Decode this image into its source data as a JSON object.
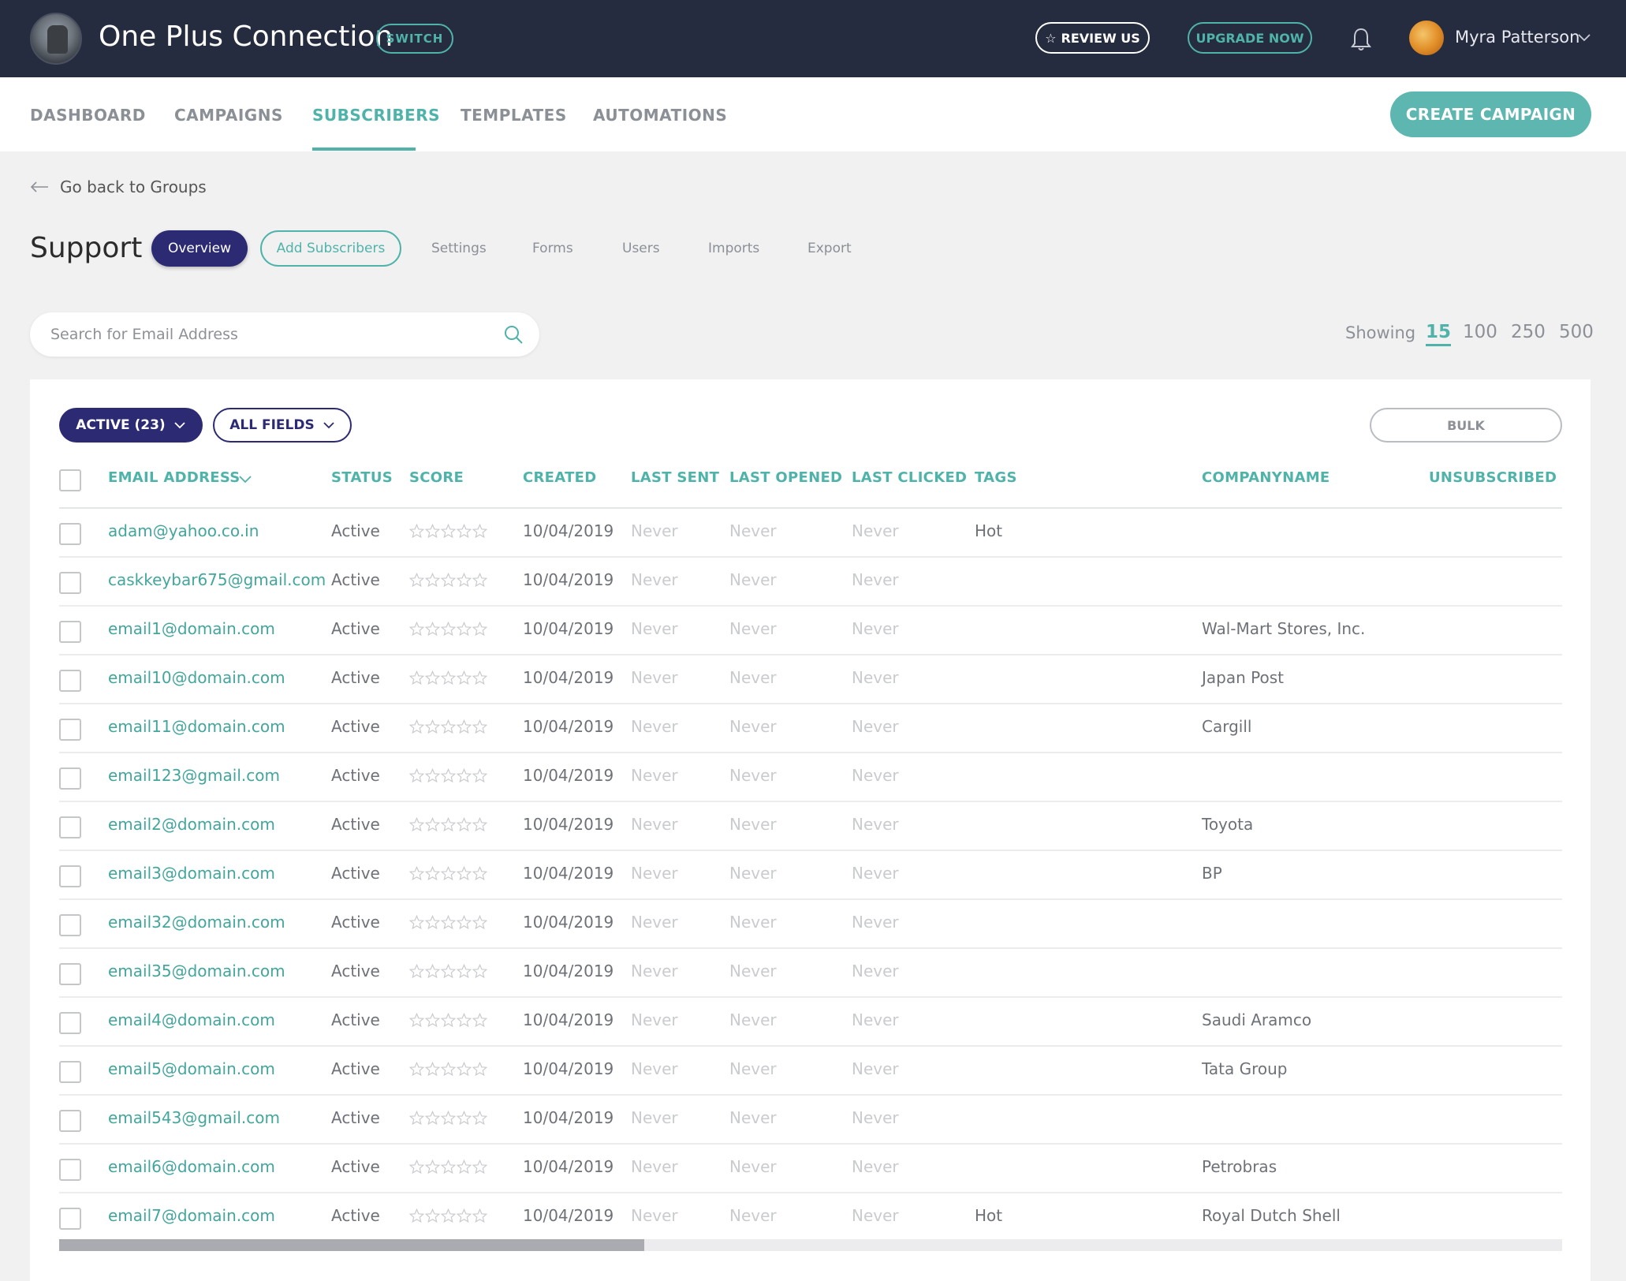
{
  "header": {
    "app_title": "One Plus Connection",
    "switch_label": "SWITCH",
    "review_label": "REVIEW US",
    "upgrade_label": "UPGRADE NOW",
    "user_name": "Myra Patterson"
  },
  "nav": {
    "items": [
      "DASHBOARD",
      "CAMPAIGNS",
      "SUBSCRIBERS",
      "TEMPLATES",
      "AUTOMATIONS"
    ],
    "active": "SUBSCRIBERS",
    "create_label": "CREATE CAMPAIGN"
  },
  "back_link": "Go back to Groups",
  "group": {
    "title": "Support",
    "overview_label": "Overview",
    "add_label": "Add Subscribers",
    "tabs": [
      "Settings",
      "Forms",
      "Users",
      "Imports",
      "Export"
    ]
  },
  "search": {
    "placeholder": "Search for Email Address"
  },
  "showing": {
    "label": "Showing",
    "options": [
      "15",
      "100",
      "250",
      "500"
    ],
    "selected": "15"
  },
  "filters": {
    "active_label": "ACTIVE (23)",
    "fields_label": "ALL FIELDS",
    "bulk_label": "BULK"
  },
  "table": {
    "columns": [
      "EMAIL ADDRESS",
      "STATUS",
      "SCORE",
      "CREATED",
      "LAST SENT",
      "LAST OPENED",
      "LAST CLICKED",
      "TAGS",
      "COMPANYNAME",
      "UNSUBSCRIBED"
    ],
    "rows": [
      {
        "email": "adam@yahoo.co.in",
        "status": "Active",
        "score": 0,
        "created": "10/04/2019",
        "last_sent": "Never",
        "last_opened": "Never",
        "last_clicked": "Never",
        "tags": "Hot",
        "company": ""
      },
      {
        "email": "caskkeybar675@gmail.com",
        "status": "Active",
        "score": 0,
        "created": "10/04/2019",
        "last_sent": "Never",
        "last_opened": "Never",
        "last_clicked": "Never",
        "tags": "",
        "company": ""
      },
      {
        "email": "email1@domain.com",
        "status": "Active",
        "score": 0,
        "created": "10/04/2019",
        "last_sent": "Never",
        "last_opened": "Never",
        "last_clicked": "Never",
        "tags": "",
        "company": "Wal-Mart Stores, Inc."
      },
      {
        "email": "email10@domain.com",
        "status": "Active",
        "score": 0,
        "created": "10/04/2019",
        "last_sent": "Never",
        "last_opened": "Never",
        "last_clicked": "Never",
        "tags": "",
        "company": "Japan Post"
      },
      {
        "email": "email11@domain.com",
        "status": "Active",
        "score": 0,
        "created": "10/04/2019",
        "last_sent": "Never",
        "last_opened": "Never",
        "last_clicked": "Never",
        "tags": "",
        "company": "Cargill"
      },
      {
        "email": "email123@gmail.com",
        "status": "Active",
        "score": 0,
        "created": "10/04/2019",
        "last_sent": "Never",
        "last_opened": "Never",
        "last_clicked": "Never",
        "tags": "",
        "company": ""
      },
      {
        "email": "email2@domain.com",
        "status": "Active",
        "score": 0,
        "created": "10/04/2019",
        "last_sent": "Never",
        "last_opened": "Never",
        "last_clicked": "Never",
        "tags": "",
        "company": "Toyota"
      },
      {
        "email": "email3@domain.com",
        "status": "Active",
        "score": 0,
        "created": "10/04/2019",
        "last_sent": "Never",
        "last_opened": "Never",
        "last_clicked": "Never",
        "tags": "",
        "company": "BP"
      },
      {
        "email": "email32@domain.com",
        "status": "Active",
        "score": 0,
        "created": "10/04/2019",
        "last_sent": "Never",
        "last_opened": "Never",
        "last_clicked": "Never",
        "tags": "",
        "company": ""
      },
      {
        "email": "email35@domain.com",
        "status": "Active",
        "score": 0,
        "created": "10/04/2019",
        "last_sent": "Never",
        "last_opened": "Never",
        "last_clicked": "Never",
        "tags": "",
        "company": ""
      },
      {
        "email": "email4@domain.com",
        "status": "Active",
        "score": 0,
        "created": "10/04/2019",
        "last_sent": "Never",
        "last_opened": "Never",
        "last_clicked": "Never",
        "tags": "",
        "company": "Saudi Aramco"
      },
      {
        "email": "email5@domain.com",
        "status": "Active",
        "score": 0,
        "created": "10/04/2019",
        "last_sent": "Never",
        "last_opened": "Never",
        "last_clicked": "Never",
        "tags": "",
        "company": "Tata Group"
      },
      {
        "email": "email543@gmail.com",
        "status": "Active",
        "score": 0,
        "created": "10/04/2019",
        "last_sent": "Never",
        "last_opened": "Never",
        "last_clicked": "Never",
        "tags": "",
        "company": ""
      },
      {
        "email": "email6@domain.com",
        "status": "Active",
        "score": 0,
        "created": "10/04/2019",
        "last_sent": "Never",
        "last_opened": "Never",
        "last_clicked": "Never",
        "tags": "",
        "company": "Petrobras"
      },
      {
        "email": "email7@domain.com",
        "status": "Active",
        "score": 0,
        "created": "10/04/2019",
        "last_sent": "Never",
        "last_opened": "Never",
        "last_clicked": "Never",
        "tags": "Hot",
        "company": "Royal Dutch Shell"
      }
    ]
  },
  "colors": {
    "topbar": "#262c3f",
    "accent": "#4fb3aa",
    "primary": "#2c2a73"
  }
}
